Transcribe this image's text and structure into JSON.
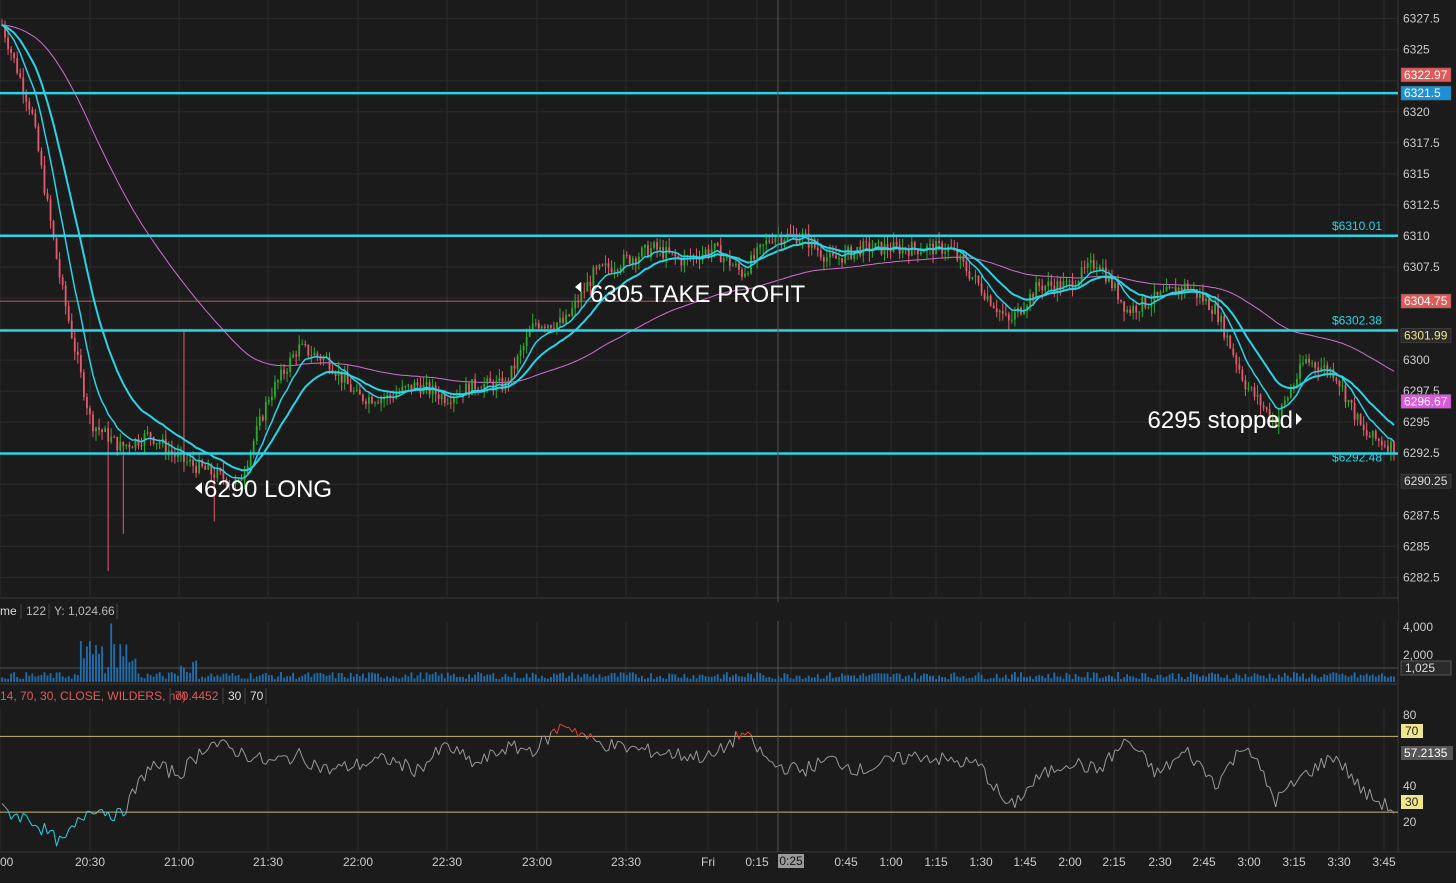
{
  "price_panel": {
    "y_ticks": [
      "6327.5",
      "6325",
      "6320",
      "6317.5",
      "6315",
      "6312.5",
      "6310",
      "6307.5",
      "6300",
      "6297.5",
      "6295",
      "6292.5",
      "6287.5",
      "6285",
      "6282.5"
    ],
    "badges": [
      {
        "label": "6322.97",
        "value": 6322.97,
        "color": "#e05a5a",
        "text": "#ffffff"
      },
      {
        "label": "6321.5",
        "value": 6321.5,
        "color": "#1e90d6",
        "text": "#ffffff"
      },
      {
        "label": "6304.75",
        "value": 6304.75,
        "color": "#e05a5a",
        "text": "#ffffff"
      },
      {
        "label": "6301.99",
        "value": 6301.99,
        "color": "#2a2a2a",
        "text": "#f0e68c"
      },
      {
        "label": "6296.67",
        "value": 6296.67,
        "color": "#e056e0",
        "text": "#ffffff"
      },
      {
        "label": "6290.25",
        "value": 6290.25,
        "color": "#2a2a2a",
        "text": "#dddddd"
      }
    ],
    "level_labels": [
      {
        "label": "$6310.01",
        "value": 6310.01
      },
      {
        "label": "$6302.38",
        "value": 6302.38
      },
      {
        "label": "$6292.48",
        "value": 6292.48
      }
    ],
    "annotations": [
      "6305 TAKE PROFIT",
      "6290 LONG",
      "6295 stopped"
    ]
  },
  "volume_panel": {
    "header": [
      "me",
      "122",
      "Y: 1,024.66"
    ],
    "y_ticks": [
      "4,000",
      "2,000"
    ],
    "badge": "1,025"
  },
  "rsi_panel": {
    "header": [
      "14, 70, 30, CLOSE, WILDERS, no)",
      "70.4452",
      "30",
      "70"
    ],
    "y_ticks": [
      "80",
      "40",
      "20"
    ],
    "badges": [
      "70",
      "57.2135",
      "30"
    ]
  },
  "x_axis": {
    "labels": [
      "00",
      "20:30",
      "21:00",
      "21:30",
      "22:00",
      "22:30",
      "23:00",
      "23:30",
      "Fri",
      "0:15",
      "0:25",
      "0:45",
      "1:00",
      "1:15",
      "1:30",
      "1:45",
      "2:00",
      "2:15",
      "2:30",
      "2:45",
      "3:00",
      "3:15",
      "3:30",
      "3:45"
    ],
    "cursor_label": "0:25"
  },
  "colors": {
    "background": "#1b1b1b",
    "grid": "#2c2c2c",
    "level_line": "#2ad4e6",
    "ema": "#2ad4e6",
    "vwap": "#d070d0",
    "up": "#2faa2f",
    "down": "#e45b6b",
    "rsi": "#9a9a9a",
    "rsi_ob": "#e04040",
    "rsi_os": "#2ad4e6",
    "rsi_band": "#c8b878"
  },
  "chart_data": [
    {
      "type": "candlestick",
      "name": "price",
      "ylim": [
        6281,
        6329
      ],
      "horizontal_levels": [
        6321.5,
        6310.01,
        6302.38,
        6292.48
      ],
      "close_path_x": [
        0,
        0.5,
        1,
        1.5,
        2,
        2.5,
        3,
        3.5,
        4,
        4.5,
        5,
        5.5,
        6,
        6.5,
        7,
        7.5,
        8,
        8.5,
        9,
        9.5,
        10,
        10.5,
        11,
        11.5,
        12,
        12.5,
        13,
        13.5,
        14,
        14.5,
        15,
        15.5,
        16,
        16.5,
        17,
        17.5,
        18,
        18.5,
        19,
        19.5,
        20,
        20.5,
        21,
        21.5,
        22,
        22.5,
        23,
        23.5
      ],
      "close_path_y": [
        6327,
        6320,
        6306,
        6295,
        6293,
        6294,
        6292,
        6291,
        6290,
        6297,
        6301,
        6300,
        6297,
        6297,
        6298,
        6297,
        6298,
        6298,
        6303,
        6303,
        6307,
        6308,
        6309,
        6308,
        6309,
        6307,
        6310,
        6310,
        6308,
        6309,
        6309,
        6309,
        6309,
        6306,
        6303,
        6306,
        6306,
        6308,
        6304,
        6305,
        6306,
        6304,
        6298,
        6295,
        6300,
        6299,
        6294,
        6293
      ]
    },
    {
      "type": "bar",
      "name": "volume",
      "ylim": [
        0,
        4200
      ]
    },
    {
      "type": "line",
      "name": "rsi",
      "ylim": [
        10,
        85
      ],
      "bands": [
        30,
        70
      ],
      "x": [
        0,
        0.5,
        1,
        1.5,
        2,
        2.5,
        3,
        3.5,
        4,
        4.5,
        5,
        5.5,
        6,
        6.5,
        7,
        7.5,
        8,
        8.5,
        9,
        9.5,
        10,
        10.5,
        11,
        11.5,
        12,
        12.5,
        13,
        13.5,
        14,
        14.5,
        15,
        15.5,
        16,
        16.5,
        17,
        17.5,
        18,
        18.5,
        19,
        19.5,
        20,
        20.5,
        21,
        21.5,
        22,
        22.5,
        23,
        23.5
      ],
      "y": [
        31,
        26,
        13,
        33,
        28,
        55,
        50,
        67,
        62,
        56,
        60,
        52,
        55,
        58,
        52,
        65,
        55,
        64,
        63,
        77,
        67,
        64,
        62,
        60,
        59,
        72,
        55,
        52,
        58,
        52,
        57,
        60,
        57,
        55,
        32,
        48,
        57,
        52,
        68,
        50,
        62,
        45,
        67,
        36,
        50,
        60,
        40,
        31
      ]
    }
  ]
}
